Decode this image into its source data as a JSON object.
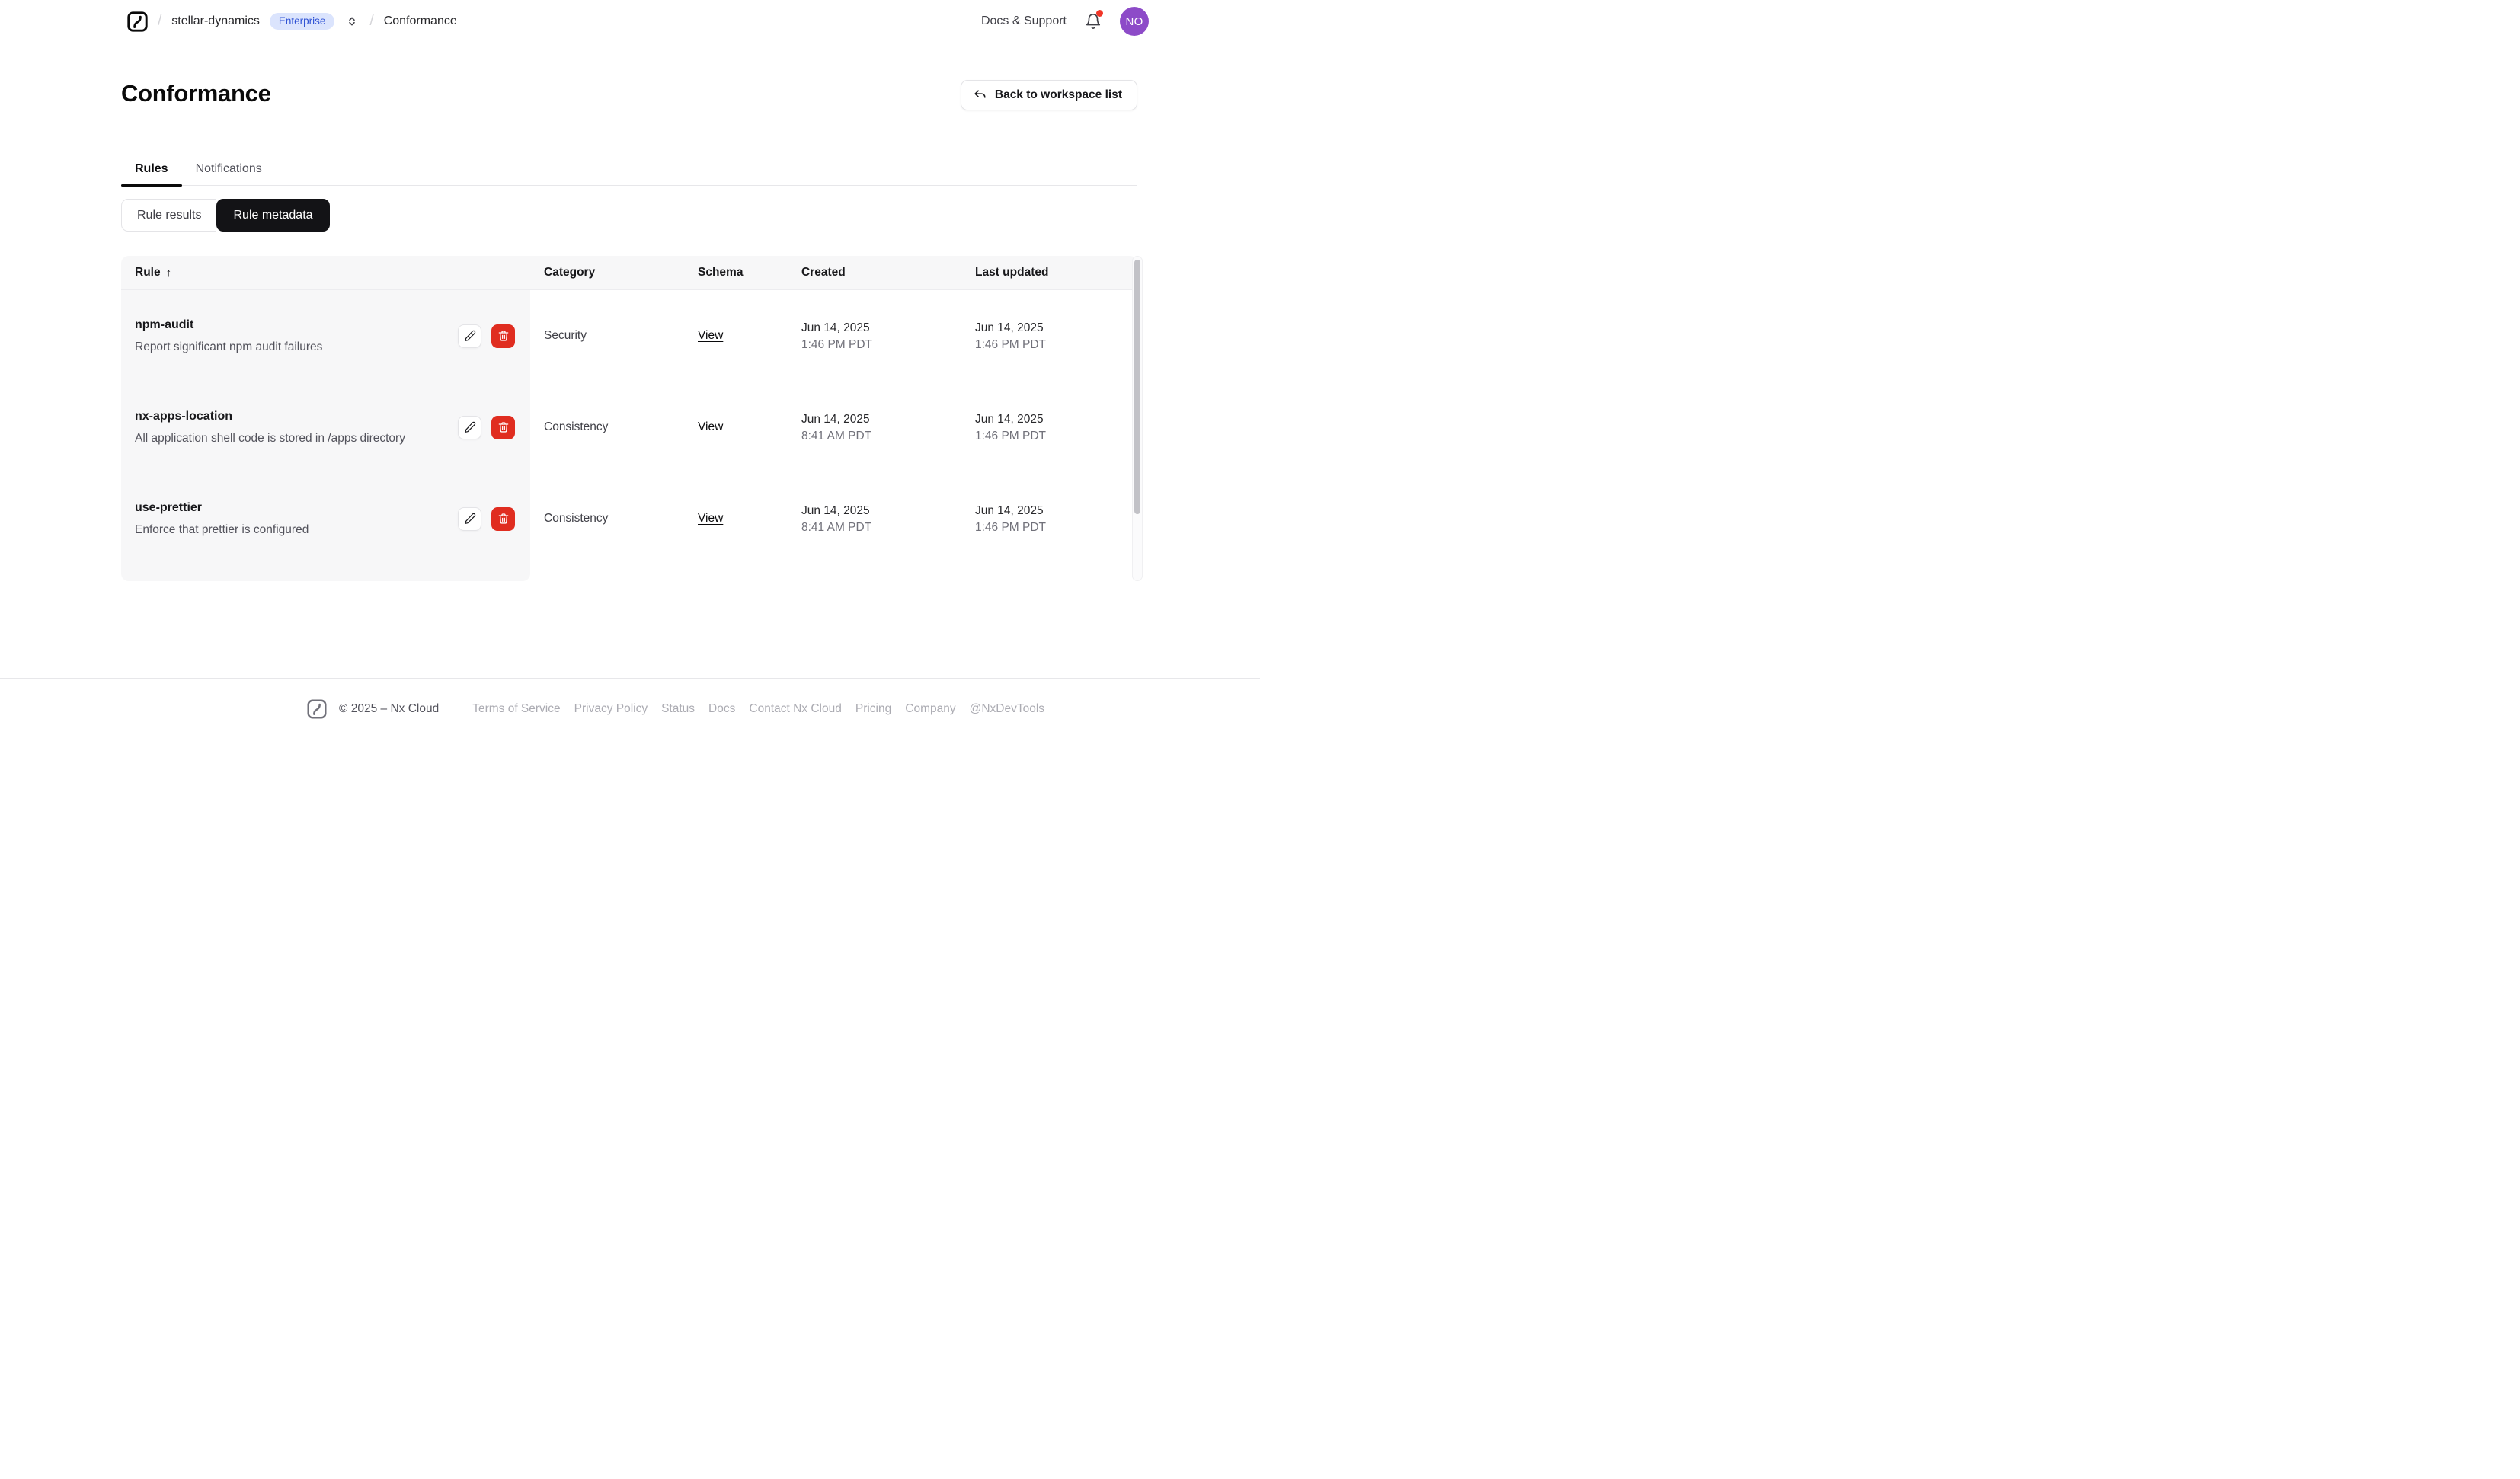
{
  "nav": {
    "separator": "/",
    "workspace": "stellar-dynamics",
    "plan_badge": "Enterprise",
    "current_page": "Conformance",
    "docs_support_label": "Docs & Support",
    "avatar_initials": "NO"
  },
  "header": {
    "title": "Conformance",
    "back_button_label": "Back to workspace list"
  },
  "tabs": [
    {
      "label": "Rules",
      "active": true
    },
    {
      "label": "Notifications",
      "active": false
    }
  ],
  "segmented_control": [
    {
      "label": "Rule results",
      "selected": false
    },
    {
      "label": "Rule metadata",
      "selected": true
    }
  ],
  "table": {
    "columns": [
      "Rule",
      "Category",
      "Schema",
      "Created",
      "Last updated"
    ],
    "sort_column": "Rule",
    "sort_direction": "ascending",
    "sort_indicator": "↑",
    "schema_link_label": "View",
    "rows": [
      {
        "name": "npm-audit",
        "description": "Report significant npm audit failures",
        "category": "Security",
        "schema_link": "View",
        "created_date": "Jun 14, 2025",
        "created_time": "1:46 PM PDT",
        "updated_date": "Jun 14, 2025",
        "updated_time": "1:46 PM PDT"
      },
      {
        "name": "nx-apps-location",
        "description": "All application shell code is stored in /apps directory",
        "category": "Consistency",
        "schema_link": "View",
        "created_date": "Jun 14, 2025",
        "created_time": "8:41 AM PDT",
        "updated_date": "Jun 14, 2025",
        "updated_time": "1:46 PM PDT"
      },
      {
        "name": "use-prettier",
        "description": "Enforce that prettier is configured",
        "category": "Consistency",
        "schema_link": "View",
        "created_date": "Jun 14, 2025",
        "created_time": "8:41 AM PDT",
        "updated_date": "Jun 14, 2025",
        "updated_time": "1:46 PM PDT"
      }
    ]
  },
  "footer": {
    "copyright": "© 2025 – Nx Cloud",
    "links": [
      "Terms of Service",
      "Privacy Policy",
      "Status",
      "Docs",
      "Contact Nx Cloud",
      "Pricing",
      "Company",
      "@NxDevTools"
    ]
  },
  "colors": {
    "badge_bg": "#dbe4fd",
    "badge_text": "#2e51d4",
    "avatar_bg": "#8d4bc8",
    "notification_dot": "#f13527",
    "delete_button": "#e02d20",
    "accent_dark": "#131316"
  }
}
